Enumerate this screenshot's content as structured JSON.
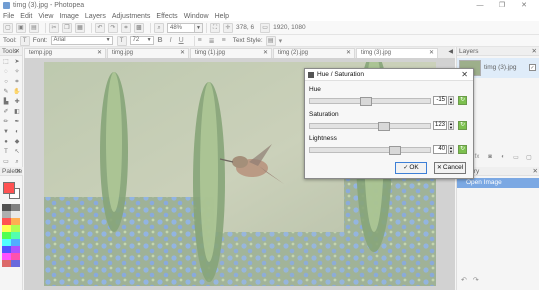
{
  "window": {
    "title": "timg (3).jpg - Photopea",
    "controls": [
      "—",
      "❐",
      "✕"
    ]
  },
  "menu": [
    "File",
    "Edit",
    "View",
    "Image",
    "Layers",
    "Adjustments",
    "Effects",
    "Window",
    "Help"
  ],
  "toolbar": {
    "zoom_value": "48%",
    "cursor_readout": "378, 6",
    "size_readout": "1920, 1080"
  },
  "options": {
    "tool_label": "Tool:",
    "font_label": "Font:",
    "font_value": "Arial",
    "font_size": "72",
    "bold": "B",
    "italic": "I",
    "underline": "U",
    "text_style_label": "Text Style:"
  },
  "tools_panel": {
    "title": "Tools",
    "palette_title": "Palette",
    "primary_color": "#ff0000",
    "secondary_color": "#ffffff"
  },
  "tabs": [
    {
      "label": "temp.jpg"
    },
    {
      "label": "timg.jpg"
    },
    {
      "label": "timg (1).jpg"
    },
    {
      "label": "timg (2).jpg"
    },
    {
      "label": "timg (3).jpg"
    }
  ],
  "layers_panel": {
    "title": "Layers",
    "layer_name": "timg (3).jpg"
  },
  "history_panel": {
    "title": "History",
    "item": "Open Image"
  },
  "dialog": {
    "title": "Hue / Saturation",
    "hue_label": "Hue",
    "hue_value": "-15",
    "saturation_label": "Saturation",
    "saturation_value": "123",
    "lightness_label": "Lightness",
    "lightness_value": "40",
    "ok_label": "OK",
    "cancel_label": "Cancel"
  }
}
